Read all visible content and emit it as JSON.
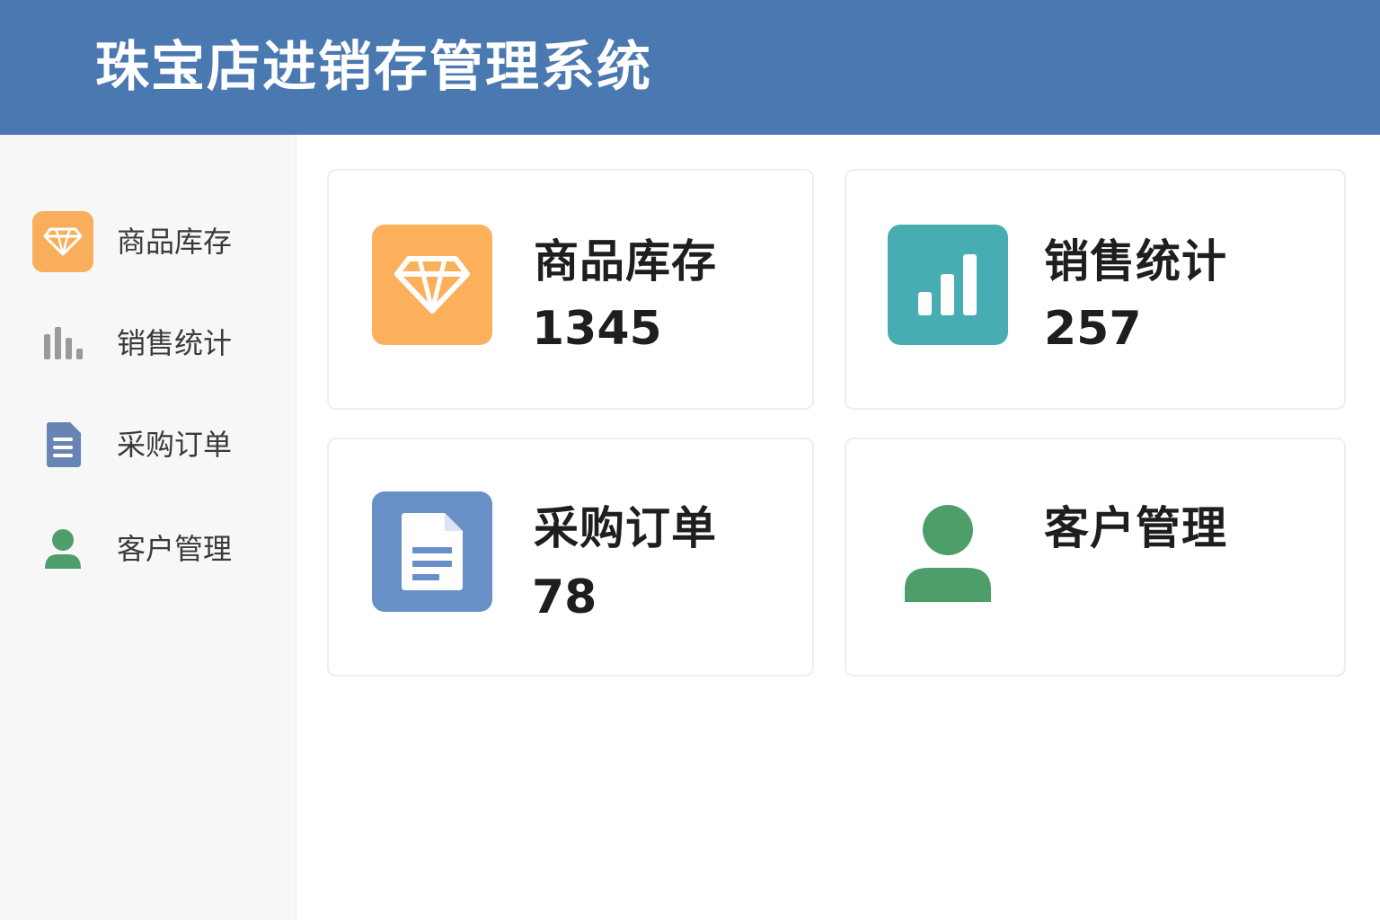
{
  "header": {
    "title": "珠宝店进销存管理系统"
  },
  "colors": {
    "header_bg": "#4a78b0",
    "inventory": "#fdb05c",
    "sales": "#48adb3",
    "purchase": "#6890c6",
    "customer": "#4e9e6a",
    "sidebar_gray_icon": "#9a9a9a"
  },
  "sidebar": {
    "items": [
      {
        "label": "商品库存",
        "icon": "diamond-icon",
        "active": true
      },
      {
        "label": "销售统计",
        "icon": "bar-chart-icon",
        "active": false
      },
      {
        "label": "采购订单",
        "icon": "document-icon",
        "active": false
      },
      {
        "label": "客户管理",
        "icon": "user-icon",
        "active": false
      }
    ]
  },
  "cards": [
    {
      "title": "商品库存",
      "value": "1345",
      "icon": "diamond-icon"
    },
    {
      "title": "销售统计",
      "value": "257",
      "icon": "bar-chart-icon"
    },
    {
      "title": "采购订单",
      "value": "78",
      "icon": "document-icon"
    },
    {
      "title": "客户管理",
      "icon": "user-icon"
    }
  ]
}
